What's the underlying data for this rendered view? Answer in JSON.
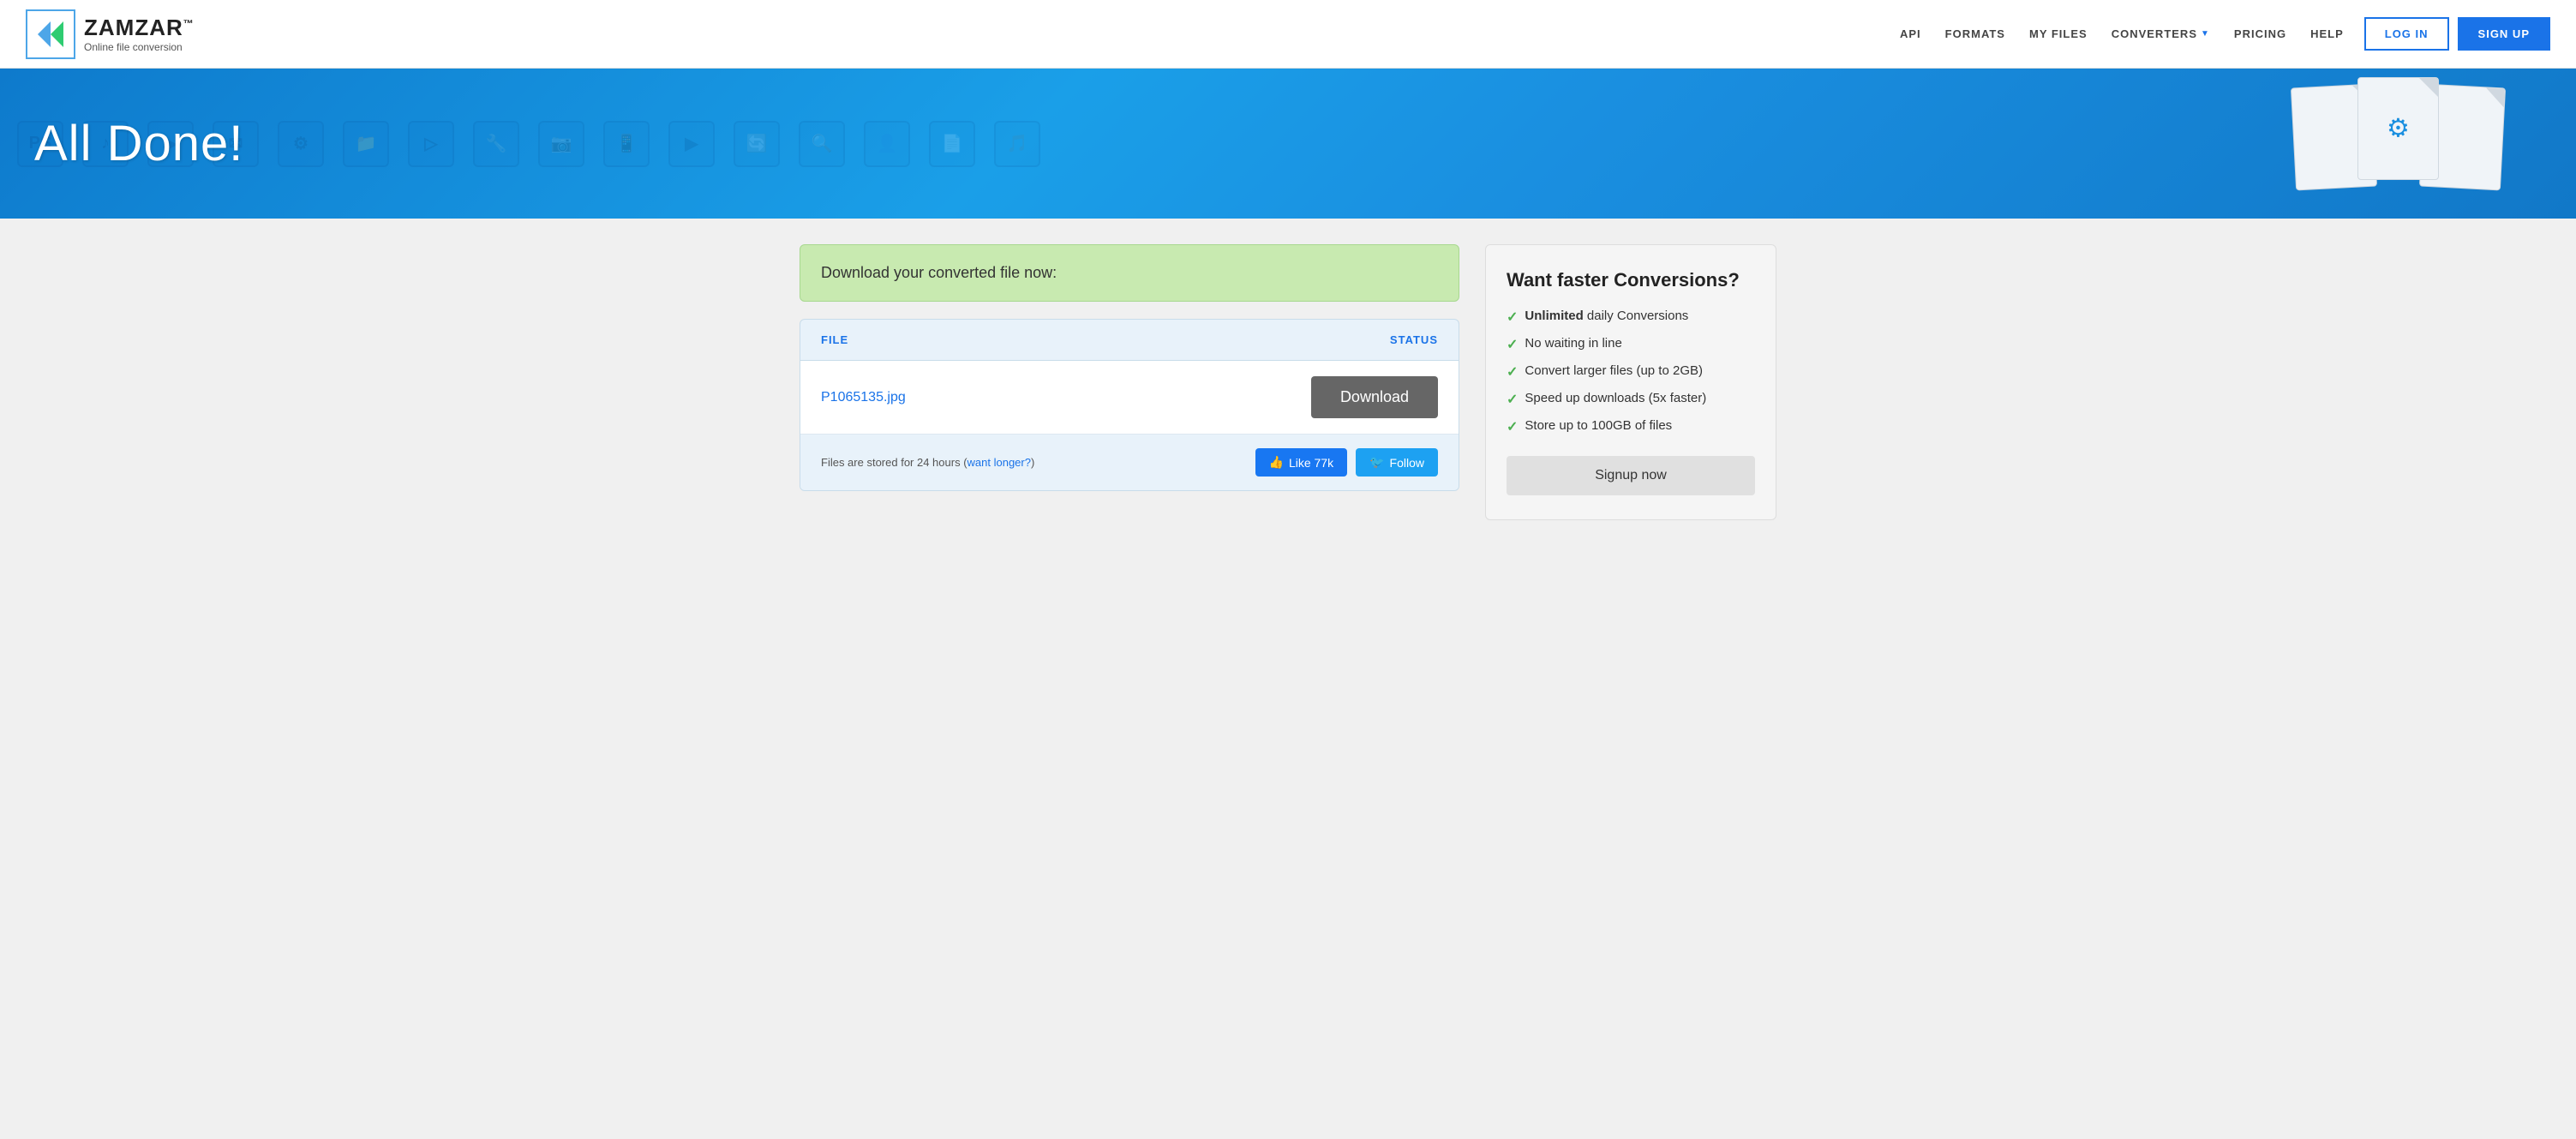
{
  "header": {
    "logo_title": "ZAMZAR",
    "logo_tm": "™",
    "logo_subtitle": "Online file conversion",
    "nav": {
      "api": "API",
      "formats": "FORMATS",
      "my_files": "MY FILES",
      "converters": "CONVERTERS",
      "pricing": "PRICING",
      "help": "HELP"
    },
    "login_label": "LOG IN",
    "signup_label": "SIGN UP"
  },
  "hero": {
    "title": "All Done!",
    "icons": [
      "PS",
      "♪",
      "▶",
      "✉",
      "⚙",
      "📁",
      "▷",
      "🔧",
      "📷",
      "📱",
      "▶",
      "🔄"
    ]
  },
  "main": {
    "success_message": "Download your converted file now:",
    "table": {
      "col_file": "FILE",
      "col_status": "STATUS",
      "file_name": "P1065135.jpg",
      "download_label": "Download"
    },
    "footer": {
      "storage_note": "Files are stored for 24 hours (",
      "want_longer": "want longer?",
      "storage_close": ")",
      "fb_label": "Like 77k",
      "twitter_label": "Follow"
    }
  },
  "promo": {
    "title": "Want faster Conversions?",
    "items": [
      {
        "bold": "Unlimited",
        "rest": " daily Conversions"
      },
      {
        "bold": "",
        "rest": "No waiting in line"
      },
      {
        "bold": "",
        "rest": "Convert larger files (up to 2GB)"
      },
      {
        "bold": "",
        "rest": "Speed up downloads (5x faster)"
      },
      {
        "bold": "",
        "rest": "Store up to 100GB of files"
      }
    ],
    "signup_label": "Signup now"
  }
}
